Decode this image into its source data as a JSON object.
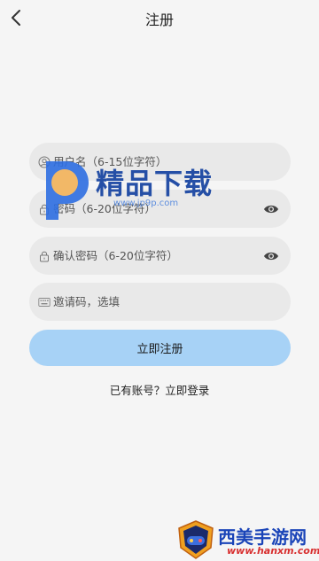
{
  "header": {
    "title": "注册",
    "back_icon": "chevron-left-icon"
  },
  "form": {
    "username": {
      "placeholder": "用户名（6-15位字符）",
      "value": "",
      "icon": "user-icon"
    },
    "password": {
      "placeholder": "密码（6-20位字符）",
      "value": "",
      "icon": "lock-icon",
      "toggle_icon": "eye-icon"
    },
    "confirm_password": {
      "placeholder": "确认密码（6-20位字符）",
      "value": "",
      "icon": "lock-icon",
      "toggle_icon": "eye-icon"
    },
    "invite_code": {
      "placeholder": "邀请码，选填",
      "value": "",
      "icon": "keyboard-icon"
    },
    "submit_label": "立即注册"
  },
  "footer": {
    "login_prompt": "已有账号？立即登录"
  },
  "watermark": {
    "center_brand": "精品下载",
    "center_url": "www.jp9p.com",
    "corner_brand": "西美手游网",
    "corner_url": "www.hanxm.com"
  },
  "colors": {
    "background": "#f5f5f5",
    "field_background": "#e9e9e9",
    "button_background": "#a7d2f6",
    "watermark_blue": "#1a44b8",
    "watermark_red": "#d83030"
  }
}
